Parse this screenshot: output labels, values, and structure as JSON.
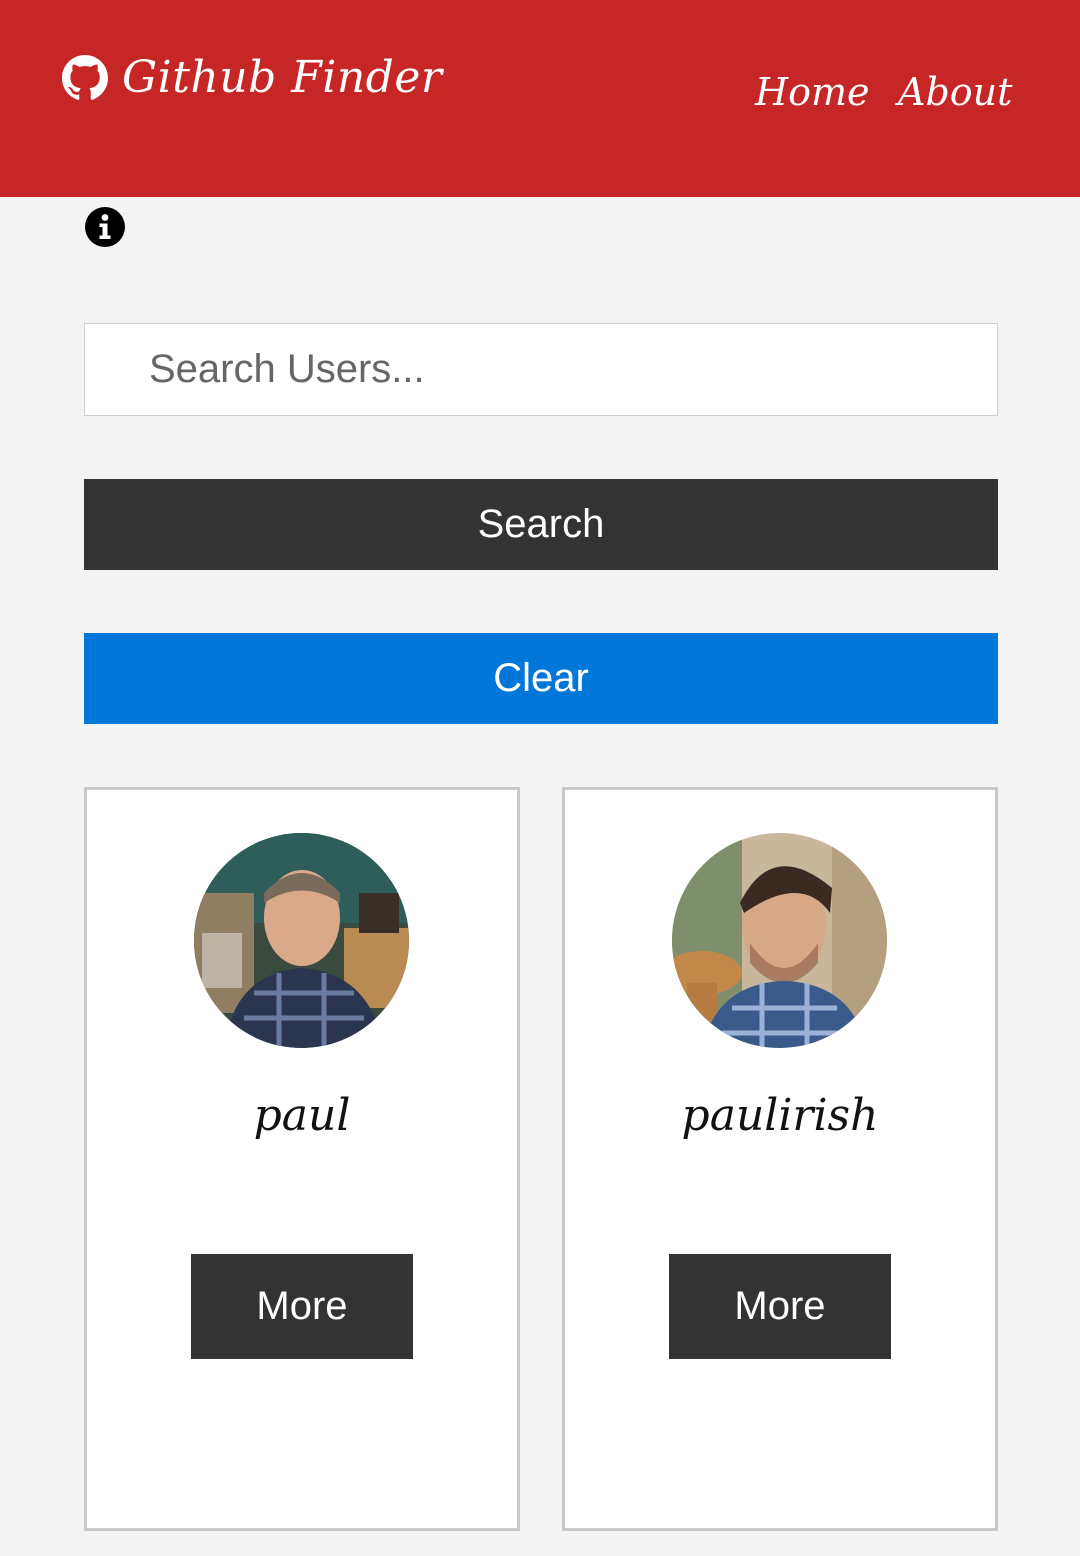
{
  "navbar": {
    "brand_icon": "github-icon",
    "brand_title": "Github Finder",
    "links": [
      {
        "label": "Home"
      },
      {
        "label": "About"
      }
    ],
    "color": "#c62626"
  },
  "info_icon": "info-icon",
  "search": {
    "placeholder": "Search Users...",
    "value": "",
    "search_label": "Search",
    "clear_label": "Clear",
    "clear_color": "#0077d9"
  },
  "users": [
    {
      "login": "paul",
      "more_label": "More",
      "avatar": "avatar-photo"
    },
    {
      "login": "paulirish",
      "more_label": "More",
      "avatar": "avatar-photo"
    }
  ]
}
